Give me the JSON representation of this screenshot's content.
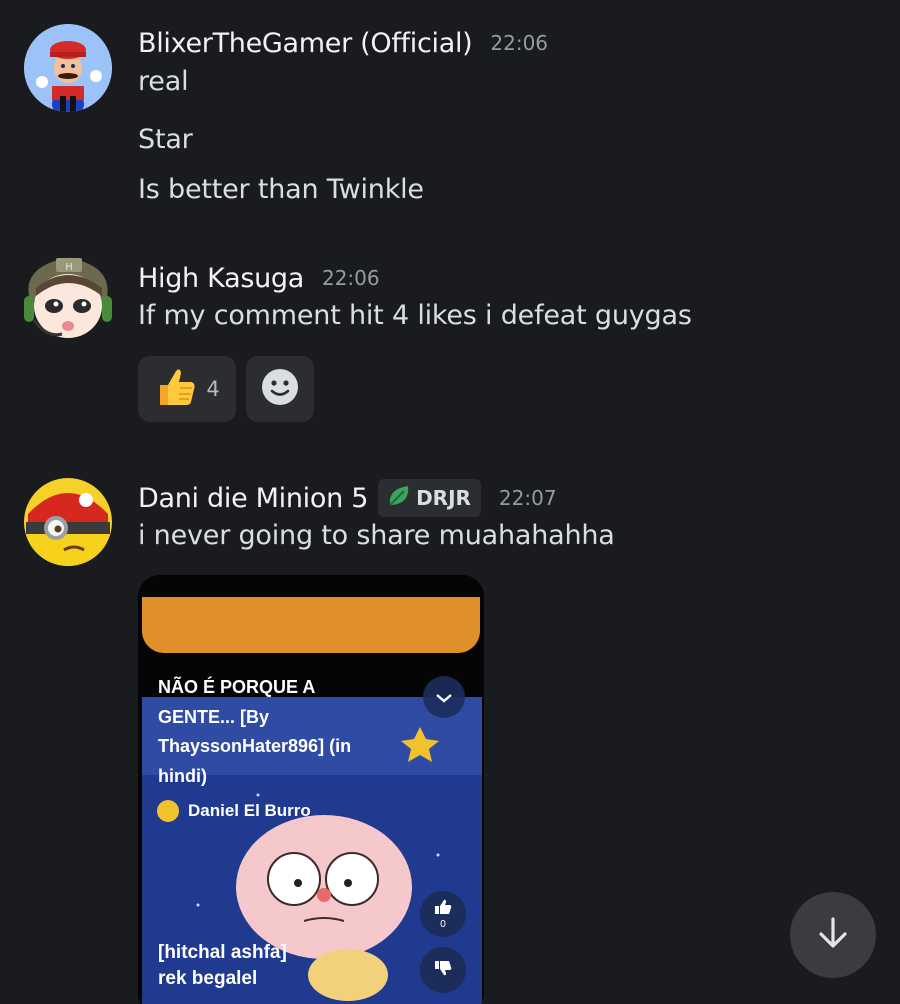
{
  "messages": [
    {
      "author": "BlixerTheGamer (Official)",
      "timestamp": "22:06",
      "lines": [
        "real",
        "Star",
        "Is better than Twinkle"
      ]
    },
    {
      "author": "High Kasuga",
      "timestamp": "22:06",
      "lines": [
        "If my comment hit 4 likes i defeat guygas"
      ],
      "reactions": [
        {
          "emoji": "thumbs-up",
          "count": "4"
        },
        {
          "emoji": "add-reaction"
        }
      ]
    },
    {
      "author": "Dani die Minion 5",
      "tag": "DRJR",
      "timestamp": "22:07",
      "lines": [
        "i never going to share muahahahha"
      ],
      "video": {
        "title": "NÃO É PORQUE A\nGENTE... [By\nThayssonHater896] (in\nhindi)",
        "channel": "Daniel El Burro",
        "caption": "[hitchal ashfa]\nrek begalel",
        "like_count": "0"
      }
    }
  ],
  "colors": {
    "background": "#1a1b1f",
    "reaction_bg": "#2b2d31",
    "timestamp": "#949ba4",
    "tag_leaf": "#3ba55c"
  }
}
